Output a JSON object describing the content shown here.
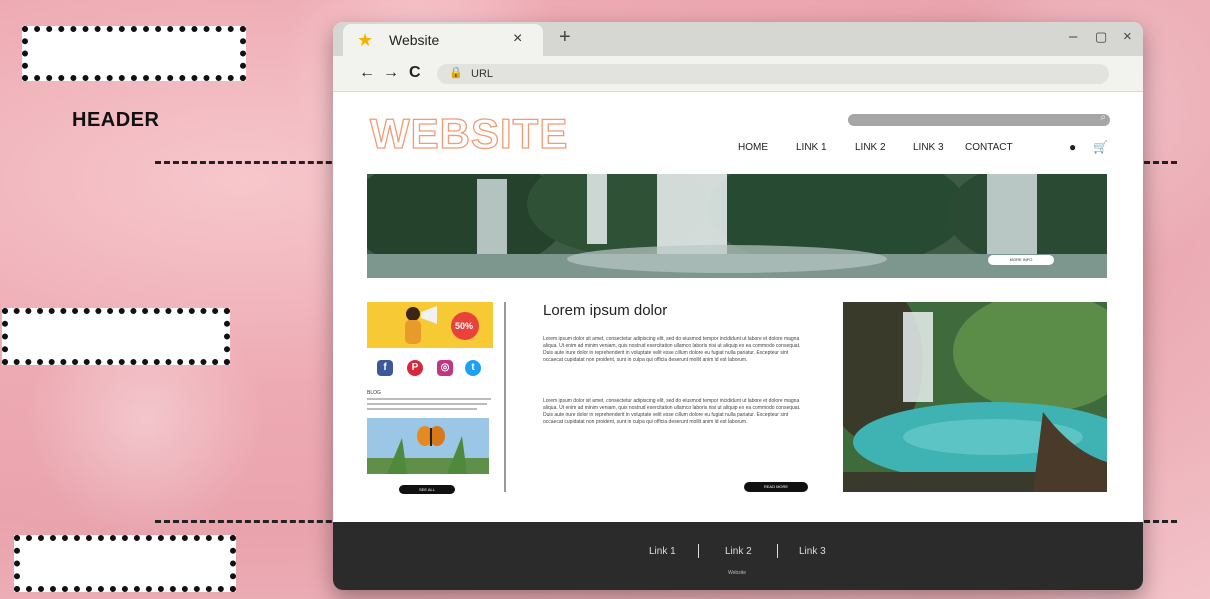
{
  "annotations": {
    "header_label": "HEADER"
  },
  "browser": {
    "tab_title": "Website",
    "tab_close": "×",
    "new_tab": "+",
    "window_controls": [
      "–",
      "▢",
      "×"
    ],
    "nav": [
      "←",
      "→",
      "C"
    ],
    "url": "URL"
  },
  "site": {
    "logo": "WEBSITE",
    "menu": [
      "HOME",
      "LINK 1",
      "LINK 2",
      "LINK 3",
      "CONTACT"
    ],
    "hero_button": "MORE INFO",
    "sidebar": {
      "ad_badge": "50%",
      "social_icons": [
        "facebook-icon",
        "pinterest-icon",
        "instagram-icon",
        "twitter-icon"
      ],
      "blog_title": "BLOG",
      "blog_button": "SEE ALL"
    },
    "article": {
      "title": "Lorem ipsum dolor",
      "paragraphs": [
        "Lorem ipsum dolor sit amet, consectetur adipiscing elit, sed do eiusmod tempor incididunt ut labore et dolore magna aliqua. Ut enim ad minim veniam, quis nostrud exercitation ullamco laboris nisi ut aliquip ex ea commodo consequat. Duis aute irure dolor in reprehenderit in voluptate velit esse cillum dolore eu fugiat nulla pariatur. Excepteur sint occaecat cupidatat non proident, sunt in culpa qui officia deserunt mollit anim id est laborum.",
        "Lorem ipsum dolor sit amet, consectetur adipiscing elit, sed do eiusmod tempor incididunt ut labore et dolore magna aliqua. Ut enim ad minim veniam, quis nostrud exercitation ullamco laboris nisi ut aliquip ex ea commodo consequat. Duis aute irure dolor in reprehenderit in voluptate velit esse cillum dolore eu fugiat nulla pariatur. Excepteur sint occaecat cupidatat non proident, sunt in culpa qui officia deserunt mollit anim id est laborum."
      ],
      "button": "READ MORE"
    },
    "footer": {
      "links": [
        "Link 1",
        "Link 2",
        "Link 3"
      ],
      "small_text": "Website"
    }
  },
  "colors": {
    "logo_outline": "#ef9c74",
    "footer_bg": "#2b2b2b",
    "ad_bg": "#f6c935",
    "facebook": "#3b5998",
    "pinterest": "#d8263c",
    "instagram": "#c13584",
    "twitter": "#1da1f2"
  }
}
